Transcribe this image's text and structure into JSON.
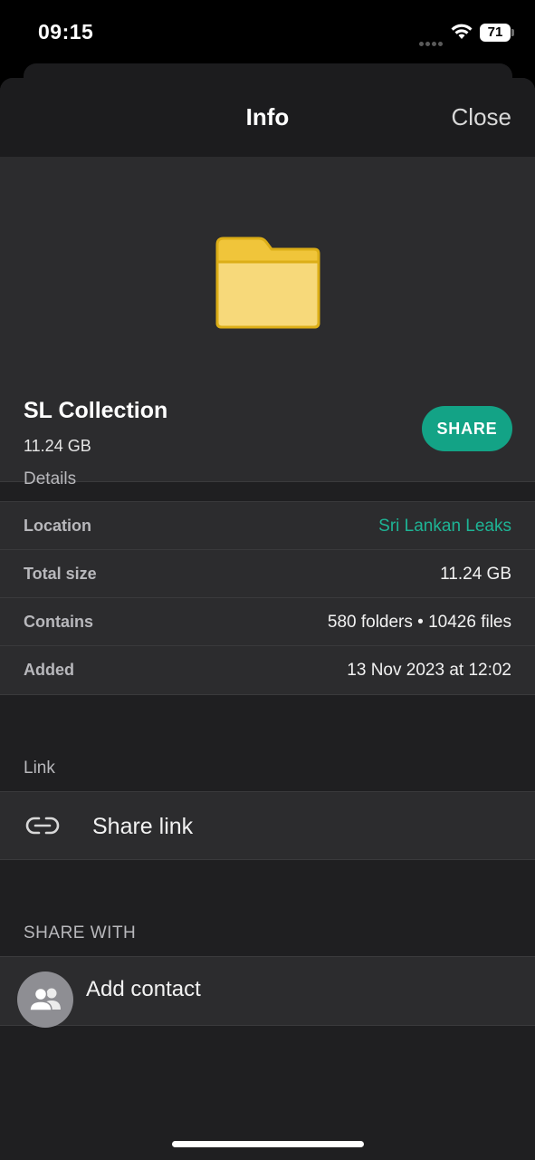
{
  "status_bar": {
    "time": "09:15",
    "battery": "71"
  },
  "header": {
    "title": "Info",
    "close_label": "Close"
  },
  "item": {
    "icon": "folder-icon",
    "name": "SL Collection",
    "size": "11.24 GB",
    "share_label": "SHARE",
    "colors": {
      "folder": "#f7d774",
      "accent": "#13a386"
    }
  },
  "details": {
    "header": "Details",
    "rows": [
      {
        "label": "Location",
        "value": "Sri Lankan Leaks"
      },
      {
        "label": "Total size",
        "value": "11.24 GB"
      },
      {
        "label": "Contains",
        "value": "580 folders • 10426 files"
      },
      {
        "label": "Added",
        "value": "13 Nov 2023 at 12:02"
      }
    ]
  },
  "link": {
    "header": "Link",
    "share_link_label": "Share link",
    "icon": "link-icon"
  },
  "share_with": {
    "header": "SHARE WITH",
    "add_contact_label": "Add contact",
    "icon": "contacts-icon"
  }
}
